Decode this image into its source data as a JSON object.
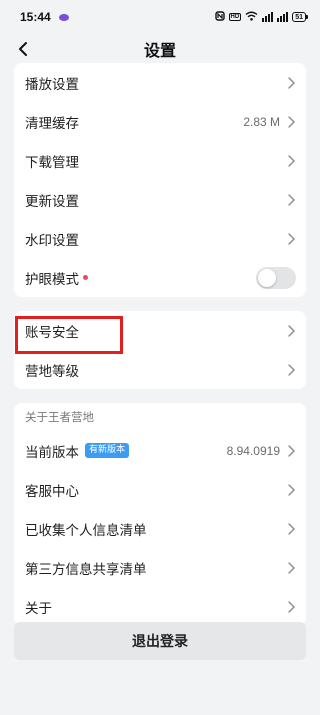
{
  "status_bar": {
    "time": "15:44",
    "battery": "51"
  },
  "nav": {
    "title": "设置"
  },
  "group1": {
    "play": "播放设置",
    "cache": "清理缓存",
    "cache_value": "2.83 M",
    "download": "下载管理",
    "update": "更新设置",
    "watermark": "水印设置",
    "eye": "护眼模式",
    "eye_enabled": false
  },
  "group2": {
    "account": "账号安全",
    "level": "营地等级"
  },
  "group3": {
    "header": "关于王者营地",
    "version": "当前版本",
    "version_badge": "有新版本",
    "version_value": "8.94.0919",
    "service": "客服中心",
    "collected": "已收集个人信息清单",
    "third_party": "第三方信息共享清单",
    "about": "关于"
  },
  "logout": {
    "label": "退出登录"
  },
  "colors": {
    "accent_red": "#e11f1f",
    "badge_blue": "#3c9cf0",
    "dot_red": "#f2485c"
  }
}
